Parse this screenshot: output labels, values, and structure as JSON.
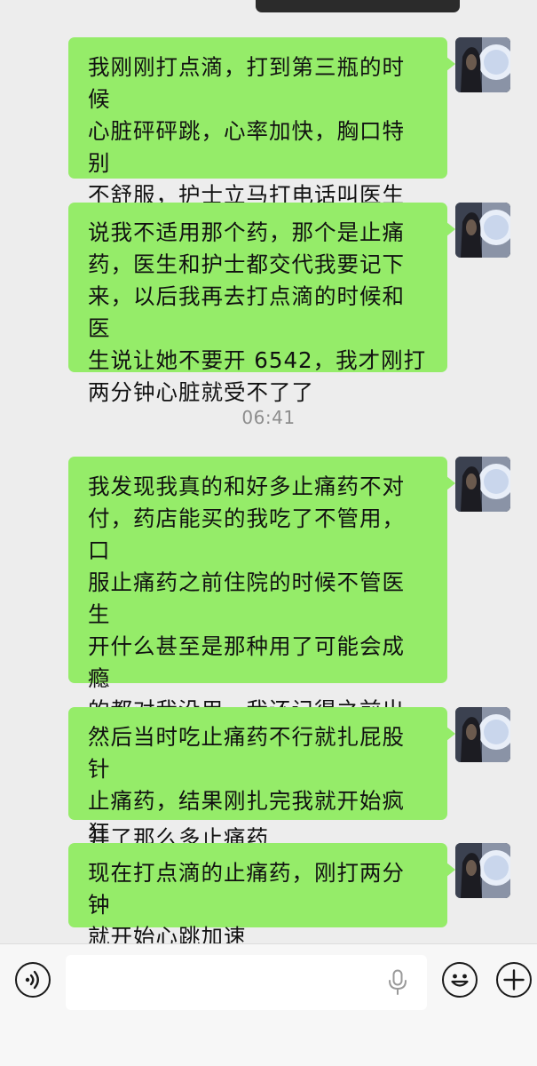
{
  "chat": {
    "messages": [
      {
        "sender": "self",
        "text": "我刚刚打点滴，打到第三瓶的时候\n心脏砰砰跳，心率加快，胸口特别\n不舒服，护士立马打电话叫医生来\n看我，然后给我停了那瓶"
      },
      {
        "sender": "self",
        "text": "说我不适用那个药，那个是止痛\n药，医生和护士都交代我要记下\n来，以后我再去打点滴的时候和医\n生说让她不要开 6542，我才刚打\n两分钟心脏就受不了了"
      },
      {
        "sender": "self",
        "text": "我发现我真的和好多止痛药不对\n付，药店能买的我吃了不管用，口\n服止痛药之前住院的时候不管医生\n开什么甚至是那种用了可能会成瘾\n的都对我没用，我还记得之前出院\n的时候那个护士说这个小姑娘怎么\n开了那么多止痛药"
      },
      {
        "sender": "self",
        "text": "然后当时吃止痛药不行就扎屁股针\n止痛药，结果刚扎完我就开始疯狂\n吐"
      },
      {
        "sender": "self",
        "text": "现在打点滴的止痛药，刚打两分钟\n就开始心跳加速"
      }
    ],
    "timestamp": "06:41"
  },
  "colors": {
    "chat_background": "#ededed",
    "self_bubble": "#95ec69",
    "timestamp_text": "#8d8d8d",
    "input_bar_background": "#f7f7f7"
  },
  "input_bar": {
    "voice_icon": "voice-icon",
    "mic_icon": "microphone-icon",
    "emoji_icon": "emoji-icon",
    "plus_icon": "plus-icon"
  }
}
